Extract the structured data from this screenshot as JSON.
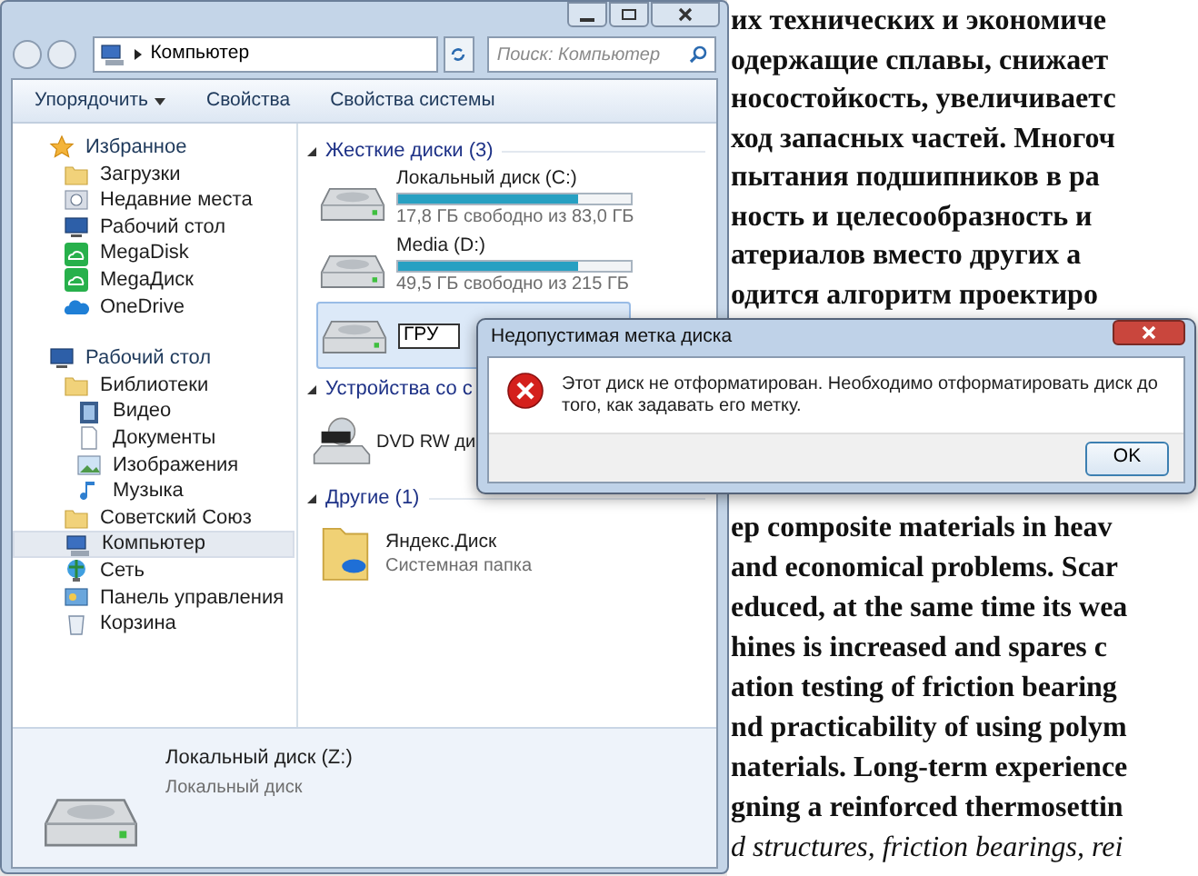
{
  "document": {
    "lines_top": [
      "их технических и экономиче",
      "одержащие сплавы, снижает",
      "носостойкость, увеличиваетс",
      "ход запасных частей. Многоч",
      "пытания подшипников в ра",
      "ность и целесообразность и",
      "атериалов  вместо других а",
      "одится алгоритм проектиро"
    ],
    "lines_bottom": [
      {
        "text": "ер composite materials in heav",
        "italic": false
      },
      {
        "text": "and economical problems. Scar",
        "italic": false
      },
      {
        "text": "educed, at the same time its wea",
        "italic": false
      },
      {
        "text": "hines is increased and spares c",
        "italic": false
      },
      {
        "text": "ation testing of friction bearing",
        "italic": false
      },
      {
        "text": "nd practicability of using polym",
        "italic": false
      },
      {
        "text": "naterials. Long-term experience",
        "italic": false
      },
      {
        "text": "gning a reinforced thermosettin",
        "italic": false
      },
      {
        "text": "d structures, friction bearings, rei",
        "italic": true
      }
    ]
  },
  "explorer": {
    "address": "Компьютер",
    "search": {
      "placeholder": "Поиск: Компьютер"
    },
    "toolbar": [
      {
        "label": "Упорядочить",
        "kind": "menu"
      },
      {
        "label": "Свойства",
        "kind": "button"
      },
      {
        "label": "Свойства системы",
        "kind": "button"
      }
    ],
    "nav": [
      {
        "label": "Избранное",
        "kind": "star",
        "selected": false,
        "children": [
          {
            "label": "Загрузки",
            "kind": "folder",
            "selected": false
          },
          {
            "label": "Недавние места",
            "kind": "recent",
            "selected": false
          },
          {
            "label": "Рабочий стол",
            "kind": "desktop",
            "selected": false
          },
          {
            "label": "MegaDisk",
            "kind": "cloud-green",
            "selected": false
          },
          {
            "label": "MegaДиск",
            "kind": "cloud-green",
            "selected": false
          },
          {
            "label": "OneDrive",
            "kind": "cloud-blue",
            "selected": false
          }
        ]
      },
      {
        "label": "Рабочий стол",
        "kind": "desktop",
        "selected": false,
        "children": [
          {
            "label": "Библиотеки",
            "kind": "folder",
            "selected": false,
            "children": [
              {
                "label": "Видео",
                "kind": "video",
                "selected": false
              },
              {
                "label": "Документы",
                "kind": "document",
                "selected": false
              },
              {
                "label": "Изображения",
                "kind": "image",
                "selected": false
              },
              {
                "label": "Музыка",
                "kind": "music",
                "selected": false
              }
            ]
          },
          {
            "label": "Советский Союз",
            "kind": "folder",
            "selected": false
          },
          {
            "label": "Компьютер",
            "kind": "computer",
            "selected": true
          },
          {
            "label": "Сеть",
            "kind": "network",
            "selected": false
          },
          {
            "label": "Панель управления",
            "kind": "control-panel",
            "selected": false
          },
          {
            "label": "Корзина",
            "kind": "recycle",
            "selected": false
          }
        ]
      }
    ],
    "groups": [
      {
        "title": "Жесткие диски (3)",
        "items": [
          {
            "kind": "drive",
            "name": "Локальный диск (C:)",
            "level": 0.77,
            "free": "17,8 ГБ свободно из 83,0 ГБ"
          },
          {
            "kind": "drive",
            "name": "Media (D:)",
            "level": 0.77,
            "free": "49,5 ГБ свободно из 215 ГБ"
          },
          {
            "kind": "rename",
            "value": "ГРУ"
          }
        ]
      },
      {
        "title": "Устройства со с",
        "items": [
          {
            "kind": "dvd",
            "name": "DVD RW ди"
          }
        ]
      },
      {
        "title": "Другие (1)",
        "items": [
          {
            "kind": "folder",
            "name": "Яндекс.Диск",
            "subtitle": "Системная папка"
          }
        ]
      }
    ],
    "details": {
      "name": "Локальный диск (Z:)",
      "type": "Локальный диск"
    }
  },
  "dialog": {
    "title": "Недопустимая метка диска",
    "message": "Этот диск не отформатирован. Необходимо отформатировать диск до того, как задавать его метку.",
    "button": "OK"
  }
}
